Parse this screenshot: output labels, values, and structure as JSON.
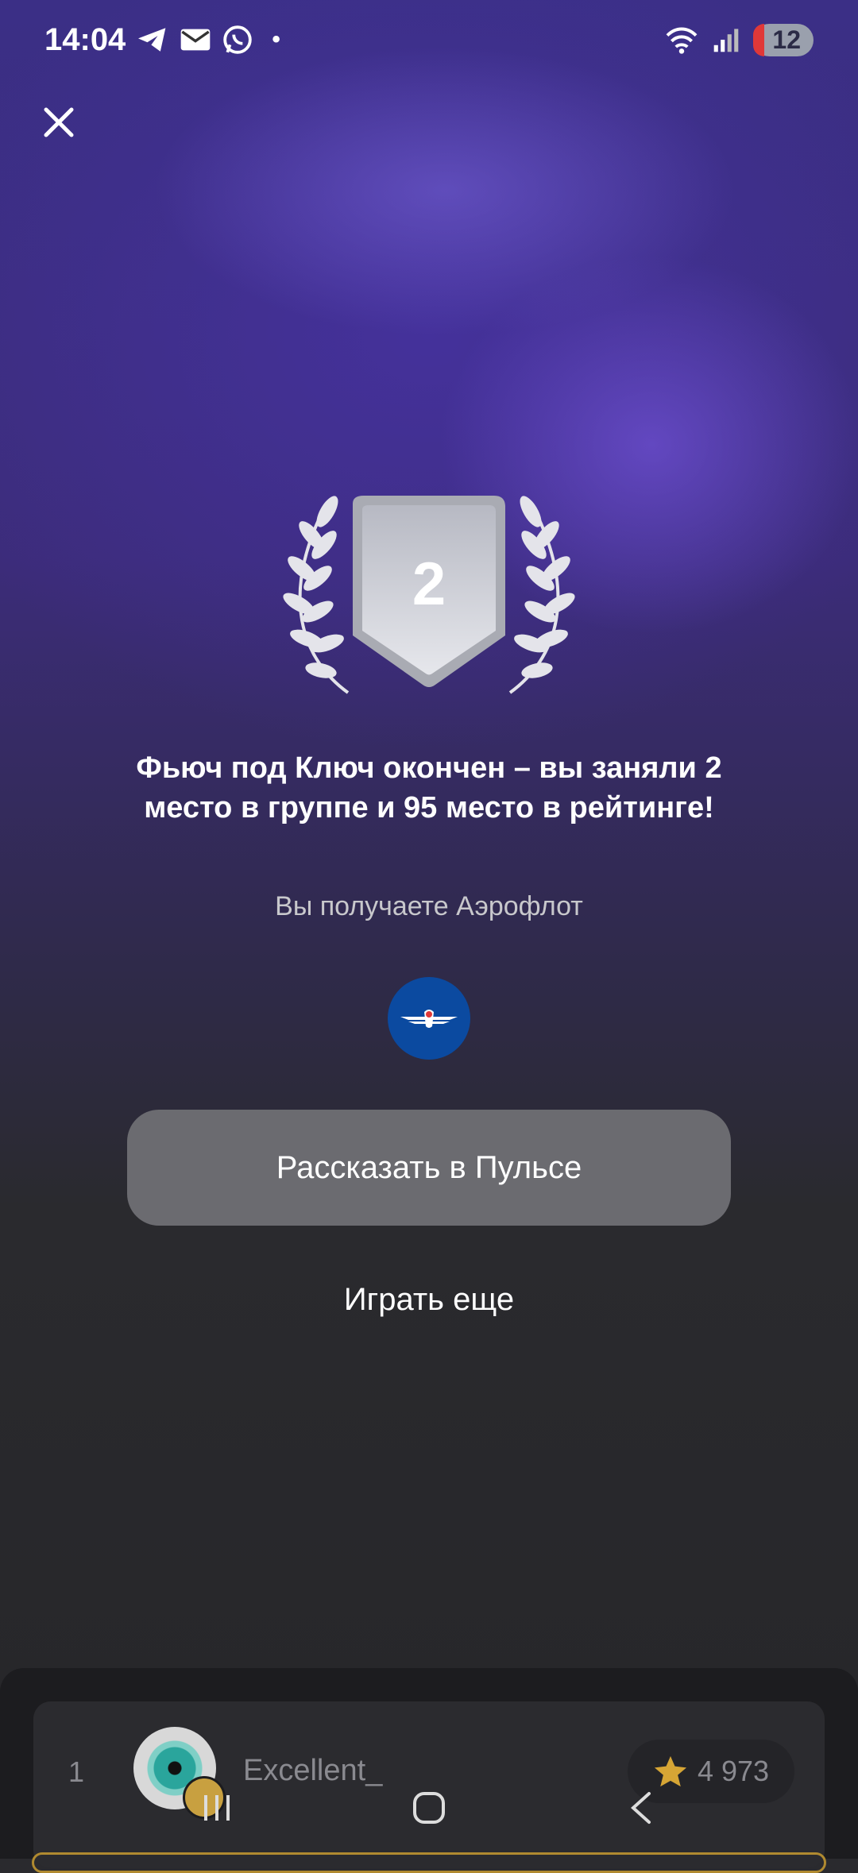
{
  "status_bar": {
    "time": "14:04",
    "battery": "12",
    "dot": "•"
  },
  "result": {
    "place": "2",
    "title": "Фьюч под Ключ окончен – вы заняли 2 место в группе и 95 место в рейтинге!",
    "subtitle": "Вы получаете Аэрофлот"
  },
  "buttons": {
    "share": "Рассказать в Пульсе",
    "play_again": "Играть еще"
  },
  "leaderboard_row": {
    "rank": "1",
    "username": "Excellent_",
    "score": "4 973"
  },
  "colors": {
    "accent_purple": "#5a3fc0",
    "aeroflot_blue": "#0b4aa0",
    "button_gray": "#6b6b70",
    "star_gold": "#d6a535"
  },
  "icons": {
    "close": "close-icon",
    "telegram": "telegram-icon",
    "mail": "mail-icon",
    "whatsapp": "whatsapp-icon",
    "wifi": "wifi-icon",
    "signal": "signal-icon",
    "laurel": "laurel-icon",
    "aeroflot_logo": "aeroflot-logo-icon",
    "star": "star-icon"
  }
}
